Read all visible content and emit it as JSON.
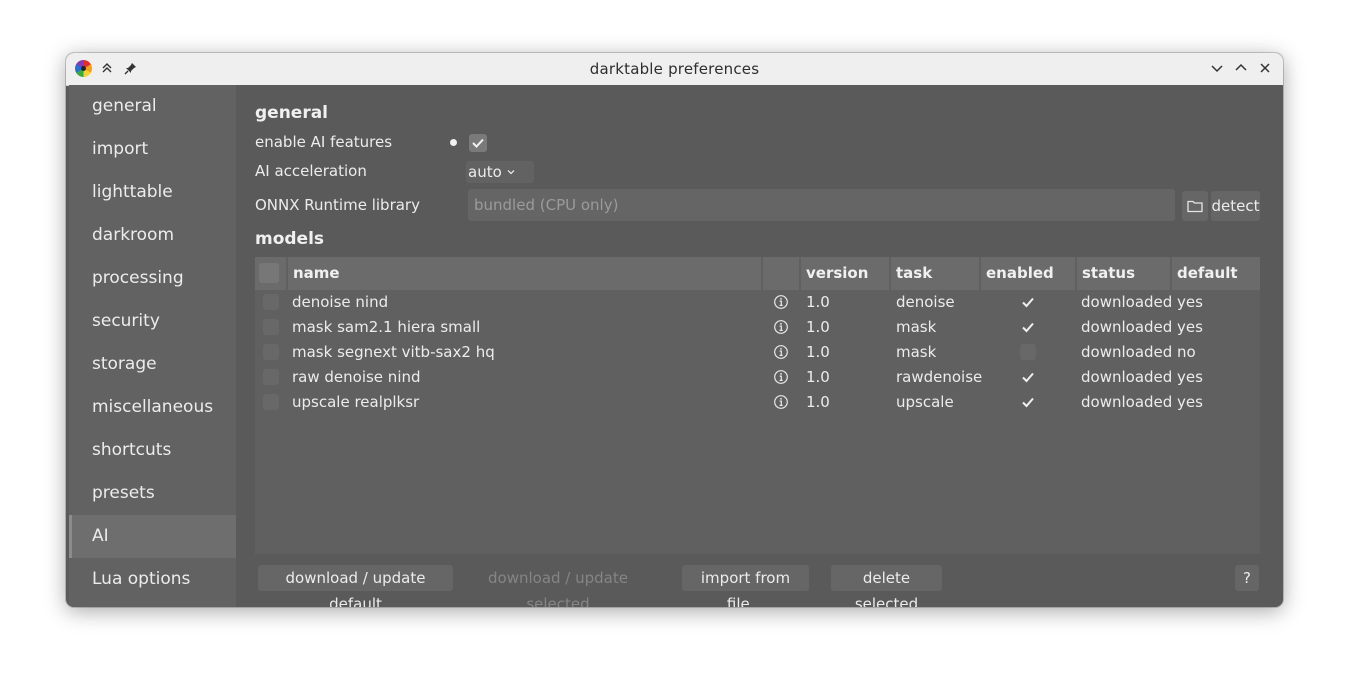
{
  "window": {
    "title": "darktable preferences"
  },
  "sidebar": {
    "items": [
      {
        "label": "general"
      },
      {
        "label": "import"
      },
      {
        "label": "lighttable"
      },
      {
        "label": "darkroom"
      },
      {
        "label": "processing"
      },
      {
        "label": "security"
      },
      {
        "label": "storage"
      },
      {
        "label": "miscellaneous"
      },
      {
        "label": "shortcuts"
      },
      {
        "label": "presets"
      },
      {
        "label": "AI"
      },
      {
        "label": "Lua options"
      }
    ],
    "active": "AI"
  },
  "general": {
    "heading": "general",
    "enable_ai_label": "enable AI features",
    "enable_ai_checked": true,
    "acceleration_label": "AI acceleration",
    "acceleration_value": "auto",
    "onnx_label": "ONNX Runtime library",
    "onnx_placeholder": "bundled (CPU only)",
    "detect_label": "detect"
  },
  "models": {
    "heading": "models",
    "columns": [
      "name",
      "",
      "version",
      "task",
      "enabled",
      "status",
      "default"
    ],
    "rows": [
      {
        "name": "denoise nind",
        "version": "1.0",
        "task": "denoise",
        "enabled": true,
        "status": "downloaded",
        "default": "yes"
      },
      {
        "name": "mask sam2.1 hiera small",
        "version": "1.0",
        "task": "mask",
        "enabled": true,
        "status": "downloaded",
        "default": "yes"
      },
      {
        "name": "mask segnext vitb-sax2 hq",
        "version": "1.0",
        "task": "mask",
        "enabled": false,
        "status": "downloaded",
        "default": "no"
      },
      {
        "name": "raw denoise nind",
        "version": "1.0",
        "task": "rawdenoise",
        "enabled": true,
        "status": "downloaded",
        "default": "yes"
      },
      {
        "name": "upscale realplksr",
        "version": "1.0",
        "task": "upscale",
        "enabled": true,
        "status": "downloaded",
        "default": "yes"
      }
    ]
  },
  "actions": {
    "download_default": "download / update default",
    "download_selected": "download / update selected",
    "import": "import from file...",
    "delete": "delete selected",
    "help": "?"
  }
}
